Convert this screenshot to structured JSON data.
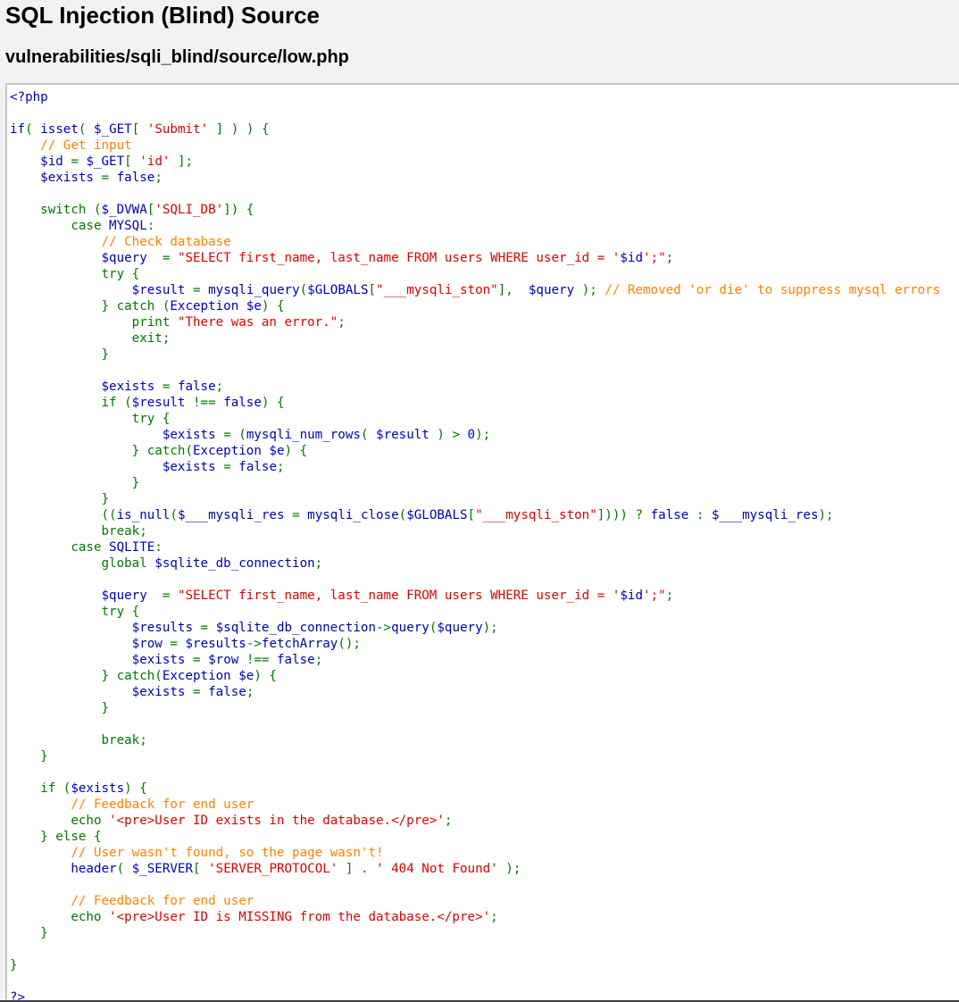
{
  "page": {
    "title": "SQL Injection (Blind) Source",
    "file_path": "vulnerabilities/sqli_blind/source/low.php"
  },
  "colors": {
    "background": "#f2f2f2",
    "code_background": "#ffffff",
    "php_default": "#0000bb",
    "php_keyword": "#007700",
    "php_string": "#dd0000",
    "php_comment": "#ff8000"
  },
  "source": {
    "lines": [
      [
        [
          "default",
          "<?php"
        ]
      ],
      [],
      [
        [
          "default",
          "if"
        ],
        [
          "keyword",
          "( "
        ],
        [
          "default",
          "isset"
        ],
        [
          "keyword",
          "( "
        ],
        [
          "default",
          "$_GET"
        ],
        [
          "keyword",
          "[ "
        ],
        [
          "string",
          "'Submit'"
        ],
        [
          "keyword",
          " ] ) ) {"
        ]
      ],
      [
        [
          "keyword",
          "    "
        ],
        [
          "comment",
          "// Get input"
        ]
      ],
      [
        [
          "keyword",
          "    "
        ],
        [
          "default",
          "$id "
        ],
        [
          "keyword",
          "= "
        ],
        [
          "default",
          "$_GET"
        ],
        [
          "keyword",
          "[ "
        ],
        [
          "string",
          "'id'"
        ],
        [
          "keyword",
          " ];"
        ]
      ],
      [
        [
          "keyword",
          "    "
        ],
        [
          "default",
          "$exists "
        ],
        [
          "keyword",
          "= "
        ],
        [
          "default",
          "false"
        ],
        [
          "keyword",
          ";"
        ]
      ],
      [],
      [
        [
          "keyword",
          "    switch ("
        ],
        [
          "default",
          "$_DVWA"
        ],
        [
          "keyword",
          "["
        ],
        [
          "string",
          "'SQLI_DB'"
        ],
        [
          "keyword",
          "]) {"
        ]
      ],
      [
        [
          "keyword",
          "        case "
        ],
        [
          "default",
          "MYSQL"
        ],
        [
          "keyword",
          ":"
        ]
      ],
      [
        [
          "keyword",
          "            "
        ],
        [
          "comment",
          "// Check database"
        ]
      ],
      [
        [
          "keyword",
          "            "
        ],
        [
          "default",
          "$query  "
        ],
        [
          "keyword",
          "= "
        ],
        [
          "string",
          "\"SELECT first_name, last_name FROM users WHERE user_id = '"
        ],
        [
          "default",
          "$id"
        ],
        [
          "string",
          "';\""
        ],
        [
          "keyword",
          ";"
        ]
      ],
      [
        [
          "keyword",
          "            try {"
        ]
      ],
      [
        [
          "keyword",
          "                "
        ],
        [
          "default",
          "$result "
        ],
        [
          "keyword",
          "= "
        ],
        [
          "default",
          "mysqli_query"
        ],
        [
          "keyword",
          "("
        ],
        [
          "default",
          "$GLOBALS"
        ],
        [
          "keyword",
          "["
        ],
        [
          "string",
          "\"___mysqli_ston\""
        ],
        [
          "keyword",
          "],  "
        ],
        [
          "default",
          "$query "
        ],
        [
          "keyword",
          "); "
        ],
        [
          "comment",
          "// Removed 'or die' to suppress mysql errors"
        ]
      ],
      [
        [
          "keyword",
          "            } catch ("
        ],
        [
          "default",
          "Exception $e"
        ],
        [
          "keyword",
          ") {"
        ]
      ],
      [
        [
          "keyword",
          "                print "
        ],
        [
          "string",
          "\"There was an error.\""
        ],
        [
          "keyword",
          ";"
        ]
      ],
      [
        [
          "keyword",
          "                exit;"
        ]
      ],
      [
        [
          "keyword",
          "            }"
        ]
      ],
      [],
      [
        [
          "keyword",
          "            "
        ],
        [
          "default",
          "$exists "
        ],
        [
          "keyword",
          "= "
        ],
        [
          "default",
          "false"
        ],
        [
          "keyword",
          ";"
        ]
      ],
      [
        [
          "keyword",
          "            if ("
        ],
        [
          "default",
          "$result "
        ],
        [
          "keyword",
          "!== "
        ],
        [
          "default",
          "false"
        ],
        [
          "keyword",
          ") {"
        ]
      ],
      [
        [
          "keyword",
          "                try {"
        ]
      ],
      [
        [
          "keyword",
          "                    "
        ],
        [
          "default",
          "$exists "
        ],
        [
          "keyword",
          "= ("
        ],
        [
          "default",
          "mysqli_num_rows"
        ],
        [
          "keyword",
          "( "
        ],
        [
          "default",
          "$result "
        ],
        [
          "keyword",
          ") > "
        ],
        [
          "default",
          "0"
        ],
        [
          "keyword",
          ");"
        ]
      ],
      [
        [
          "keyword",
          "                } catch("
        ],
        [
          "default",
          "Exception $e"
        ],
        [
          "keyword",
          ") {"
        ]
      ],
      [
        [
          "keyword",
          "                    "
        ],
        [
          "default",
          "$exists "
        ],
        [
          "keyword",
          "= "
        ],
        [
          "default",
          "false"
        ],
        [
          "keyword",
          ";"
        ]
      ],
      [
        [
          "keyword",
          "                }"
        ]
      ],
      [
        [
          "keyword",
          "            }"
        ]
      ],
      [
        [
          "keyword",
          "            (("
        ],
        [
          "default",
          "is_null"
        ],
        [
          "keyword",
          "("
        ],
        [
          "default",
          "$___mysqli_res "
        ],
        [
          "keyword",
          "= "
        ],
        [
          "default",
          "mysqli_close"
        ],
        [
          "keyword",
          "("
        ],
        [
          "default",
          "$GLOBALS"
        ],
        [
          "keyword",
          "["
        ],
        [
          "string",
          "\"___mysqli_ston\""
        ],
        [
          "keyword",
          "]))) ? "
        ],
        [
          "default",
          "false "
        ],
        [
          "keyword",
          ": "
        ],
        [
          "default",
          "$___mysqli_res"
        ],
        [
          "keyword",
          ");"
        ]
      ],
      [
        [
          "keyword",
          "            break;"
        ]
      ],
      [
        [
          "keyword",
          "        case "
        ],
        [
          "default",
          "SQLITE"
        ],
        [
          "keyword",
          ":"
        ]
      ],
      [
        [
          "keyword",
          "            global "
        ],
        [
          "default",
          "$sqlite_db_connection"
        ],
        [
          "keyword",
          ";"
        ]
      ],
      [],
      [
        [
          "keyword",
          "            "
        ],
        [
          "default",
          "$query  "
        ],
        [
          "keyword",
          "= "
        ],
        [
          "string",
          "\"SELECT first_name, last_name FROM users WHERE user_id = '"
        ],
        [
          "default",
          "$id"
        ],
        [
          "string",
          "';\""
        ],
        [
          "keyword",
          ";"
        ]
      ],
      [
        [
          "keyword",
          "            try {"
        ]
      ],
      [
        [
          "keyword",
          "                "
        ],
        [
          "default",
          "$results "
        ],
        [
          "keyword",
          "= "
        ],
        [
          "default",
          "$sqlite_db_connection"
        ],
        [
          "keyword",
          "->"
        ],
        [
          "default",
          "query"
        ],
        [
          "keyword",
          "("
        ],
        [
          "default",
          "$query"
        ],
        [
          "keyword",
          ");"
        ]
      ],
      [
        [
          "keyword",
          "                "
        ],
        [
          "default",
          "$row "
        ],
        [
          "keyword",
          "= "
        ],
        [
          "default",
          "$results"
        ],
        [
          "keyword",
          "->"
        ],
        [
          "default",
          "fetchArray"
        ],
        [
          "keyword",
          "();"
        ]
      ],
      [
        [
          "keyword",
          "                "
        ],
        [
          "default",
          "$exists "
        ],
        [
          "keyword",
          "= "
        ],
        [
          "default",
          "$row "
        ],
        [
          "keyword",
          "!== "
        ],
        [
          "default",
          "false"
        ],
        [
          "keyword",
          ";"
        ]
      ],
      [
        [
          "keyword",
          "            } catch("
        ],
        [
          "default",
          "Exception $e"
        ],
        [
          "keyword",
          ") {"
        ]
      ],
      [
        [
          "keyword",
          "                "
        ],
        [
          "default",
          "$exists "
        ],
        [
          "keyword",
          "= "
        ],
        [
          "default",
          "false"
        ],
        [
          "keyword",
          ";"
        ]
      ],
      [
        [
          "keyword",
          "            }"
        ]
      ],
      [],
      [
        [
          "keyword",
          "            break;"
        ]
      ],
      [
        [
          "keyword",
          "    }"
        ]
      ],
      [],
      [
        [
          "keyword",
          "    if ("
        ],
        [
          "default",
          "$exists"
        ],
        [
          "keyword",
          ") {"
        ]
      ],
      [
        [
          "keyword",
          "        "
        ],
        [
          "comment",
          "// Feedback for end user"
        ]
      ],
      [
        [
          "keyword",
          "        echo "
        ],
        [
          "string",
          "'<pre>User ID exists in the database.</pre>'"
        ],
        [
          "keyword",
          ";"
        ]
      ],
      [
        [
          "keyword",
          "    } else {"
        ]
      ],
      [
        [
          "keyword",
          "        "
        ],
        [
          "comment",
          "// User wasn't found, so the page wasn't!"
        ]
      ],
      [
        [
          "keyword",
          "        "
        ],
        [
          "default",
          "header"
        ],
        [
          "keyword",
          "( "
        ],
        [
          "default",
          "$_SERVER"
        ],
        [
          "keyword",
          "[ "
        ],
        [
          "string",
          "'SERVER_PROTOCOL' "
        ],
        [
          "keyword",
          "] . "
        ],
        [
          "string",
          "' 404 Not Found' "
        ],
        [
          "keyword",
          ");"
        ]
      ],
      [],
      [
        [
          "keyword",
          "        "
        ],
        [
          "comment",
          "// Feedback for end user"
        ]
      ],
      [
        [
          "keyword",
          "        echo "
        ],
        [
          "string",
          "'<pre>User ID is MISSING from the database.</pre>'"
        ],
        [
          "keyword",
          ";"
        ]
      ],
      [
        [
          "keyword",
          "    }"
        ]
      ],
      [],
      [
        [
          "keyword",
          "}"
        ]
      ],
      [],
      [
        [
          "default",
          "?>"
        ]
      ]
    ]
  }
}
